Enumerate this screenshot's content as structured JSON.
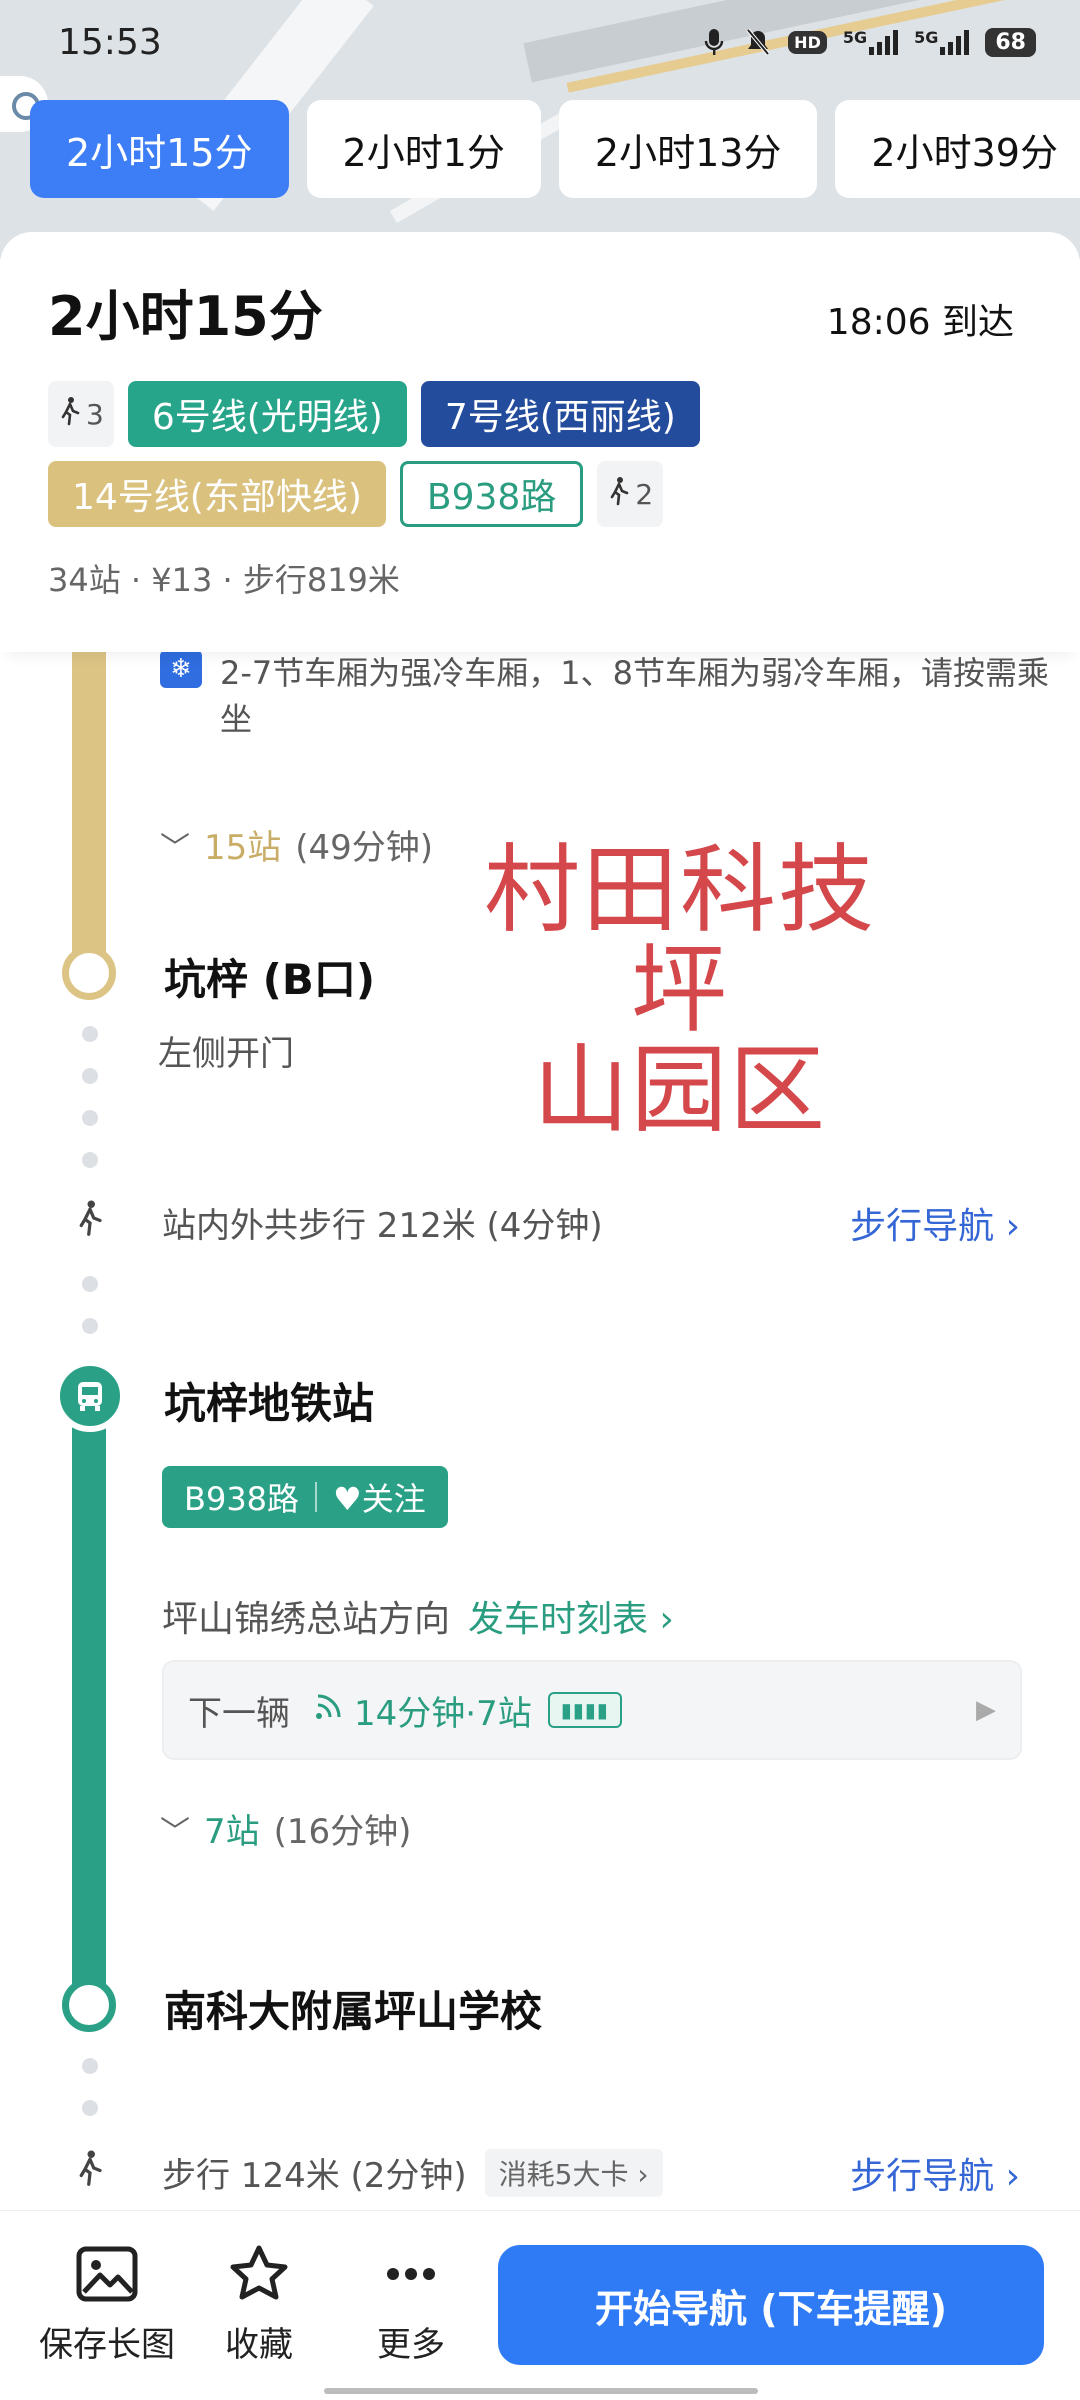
{
  "status_bar": {
    "time": "15:53",
    "network_1": "5G",
    "network_2": "5G",
    "hd_label": "HD",
    "battery": "68"
  },
  "route_tabs": [
    {
      "label": "2小时15分",
      "selected": true
    },
    {
      "label": "2小时1分",
      "selected": false
    },
    {
      "label": "2小时13分",
      "selected": false
    },
    {
      "label": "2小时39分",
      "selected": false
    }
  ],
  "summary": {
    "duration": "2小时15分",
    "arrival": "18:06 到达",
    "chips": {
      "walk_start": "3",
      "line6": "6号线(光明线)",
      "line7": "7号线(西丽线)",
      "line14": "14号线(东部快线)",
      "bus": "B938路",
      "walk_end": "2"
    },
    "meta": "34站 · ¥13 · 步行819米"
  },
  "colors": {
    "accent": "#2f7bf6",
    "line6": "#27a58b",
    "line7": "#244c9c",
    "line14": "#dbc17e",
    "bus": "#2aa186",
    "watermark": "#d4484b"
  },
  "timeline": {
    "carriage_tip": "2-7节车厢为强冷车厢，1、8节车厢为弱冷车厢，请按需乘坐",
    "metro_segment": {
      "stations": "15站",
      "duration": "(49分钟)"
    },
    "metro_exit": {
      "name": "坑梓 (B口)",
      "note": "左侧开门"
    },
    "transfer_walk": {
      "text": "站内外共步行 212米 (4分钟)",
      "nav": "步行导航 ›"
    },
    "bus_stop": {
      "name": "坑梓地铁站",
      "route": "B938路",
      "follow": "关注",
      "direction": "坪山锦绣总站方向",
      "timetable": "发车时刻表 ›",
      "next_label": "下一辆",
      "next_info": "14分钟·7站"
    },
    "bus_segment": {
      "stations": "7站",
      "duration": "(16分钟)"
    },
    "bus_exit": {
      "name": "南科大附属坪山学校"
    },
    "final_walk": {
      "text": "步行 124米 (2分钟)",
      "kcal": "消耗5大卡 ›",
      "nav": "步行导航 ›"
    }
  },
  "watermark": {
    "line1": "村田科技坪",
    "line2": "山园区"
  },
  "bottom_bar": {
    "save_image": "保存长图",
    "favorite": "收藏",
    "more": "更多",
    "start_nav": "开始导航 (下车提醒)"
  }
}
